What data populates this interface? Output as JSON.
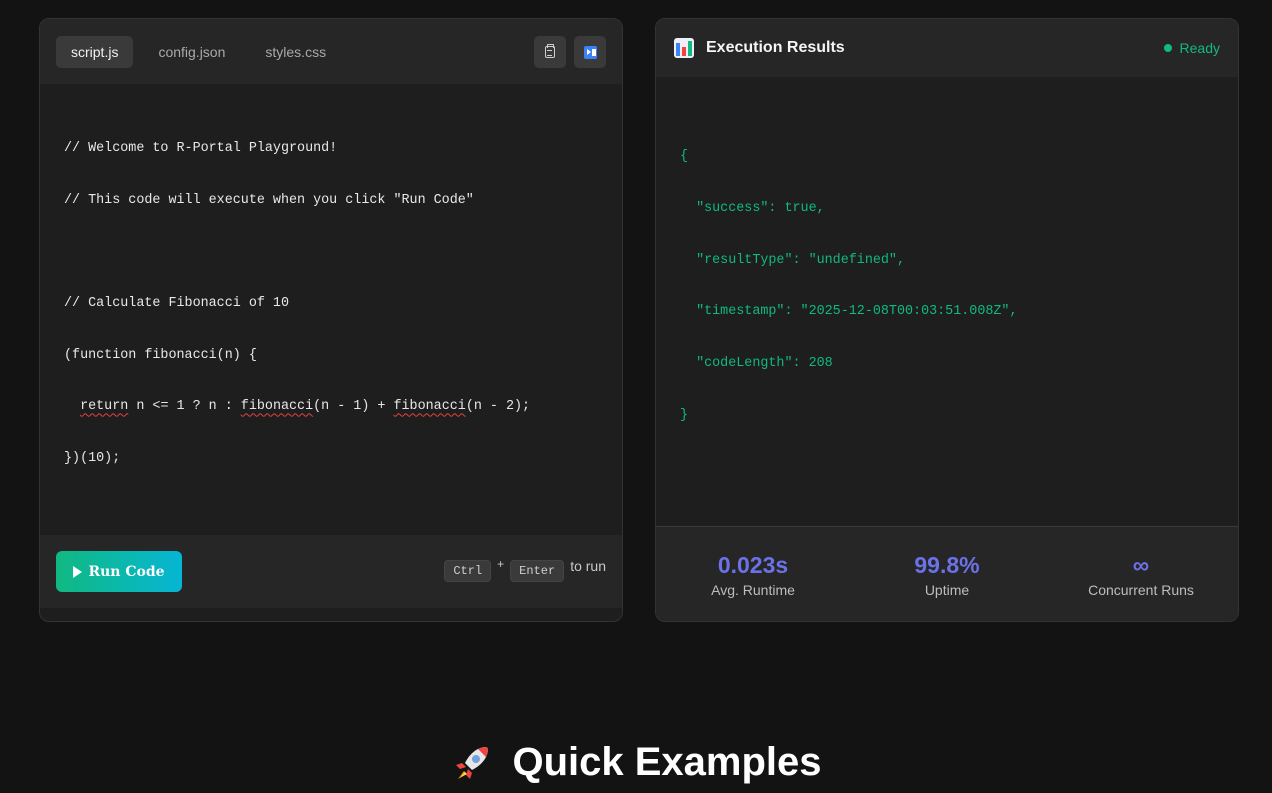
{
  "editor": {
    "tabs": [
      {
        "label": "script.js",
        "active": true
      },
      {
        "label": "config.json",
        "active": false
      },
      {
        "label": "styles.css",
        "active": false
      }
    ],
    "tools": [
      {
        "icon": "clipboard-icon"
      },
      {
        "icon": "play-pause-icon"
      }
    ],
    "code": {
      "line1": "// Welcome to R-Portal Playground!",
      "line2": "// This code will execute when you click \"Run Code\"",
      "line3": "// Calculate Fibonacci of 10",
      "line4": "(function fibonacci(n) {",
      "line5_indent": "  ",
      "line5_kw": "return",
      "line5_a": " n <= 1 ? n : ",
      "line5_fn1": "fibonacci",
      "line5_b": "(n - 1) + ",
      "line5_fn2": "fibonacci",
      "line5_c": "(n - 2);",
      "line6": "})(10);"
    },
    "footer": {
      "run_label": "Run Code",
      "key1": "Ctrl",
      "plus": "+",
      "key2": "Enter",
      "hint": "to run"
    }
  },
  "results": {
    "title": "Execution Results",
    "status": "Ready",
    "status_color": "#10b981",
    "json_lines": [
      "{",
      "  \"success\": true,",
      "  \"resultType\": \"undefined\",",
      "  \"timestamp\": \"2025-12-08T00:03:51.008Z\",",
      "  \"codeLength\": 208",
      "}"
    ],
    "stats": [
      {
        "value": "0.023s",
        "label": "Avg. Runtime"
      },
      {
        "value": "99.8%",
        "label": "Uptime"
      },
      {
        "value": "∞",
        "label": "Concurrent Runs"
      }
    ]
  },
  "section": {
    "title": "Quick Examples",
    "icon": "rocket-icon"
  },
  "colors": {
    "accent": "#6b72e8",
    "success": "#10b981",
    "run_gradient_start": "#10b981",
    "run_gradient_end": "#06b6d4"
  }
}
